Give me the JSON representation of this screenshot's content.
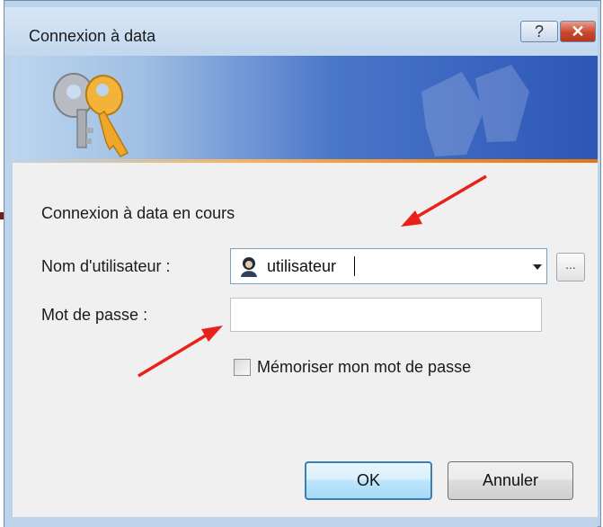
{
  "window": {
    "title": "Connexion à data",
    "help_label": "?",
    "close_label": "✕"
  },
  "dialog": {
    "status_text": "Connexion à data en cours",
    "username_label": "Nom d'utilisateur :",
    "username_value": "utilisateur",
    "browse_label": "...",
    "password_label": "Mot de passe :",
    "password_value": "",
    "remember_label": "Mémoriser mon mot de passe",
    "remember_checked": false,
    "ok_label": "OK",
    "cancel_label": "Annuler"
  },
  "colors": {
    "annotation_arrow": "#e8221b",
    "banner_dark": "#2d56b7",
    "banner_accent": "#f08a24"
  },
  "icons": [
    "keys-icon",
    "user-icon",
    "chevron-down-icon",
    "help-icon",
    "close-icon"
  ]
}
